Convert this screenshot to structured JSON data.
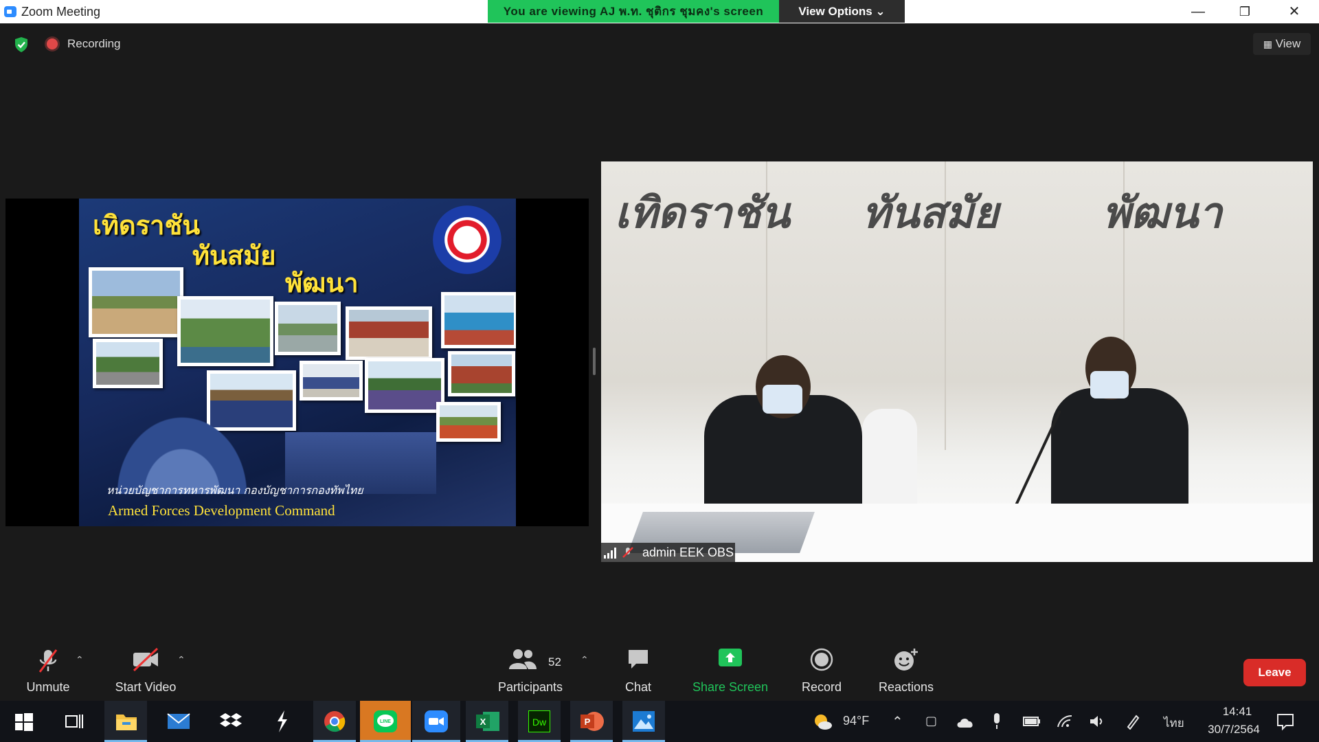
{
  "window": {
    "title": "Zoom Meeting",
    "viewing_banner": "You are viewing AJ พ.ท. ชุติกร ชุมคง's screen",
    "view_options": "View Options ⌄",
    "minimize": "—",
    "restore": "❐",
    "close": "✕"
  },
  "overlay": {
    "recording_label": "Recording",
    "view_label": "View"
  },
  "shared_slide": {
    "title_line1": "เทิดราชัน",
    "title_line2": "ทันสมัย",
    "title_line3": "พัฒนา",
    "caption_th": "หน่วยบัญชาการทหารพัฒนา  กองบัญชาการกองทัพไทย",
    "caption_en": "Armed Forces Development Command",
    "logo_text": "หน่วยบัญชาการทหารพัฒนา"
  },
  "camera": {
    "banner_words": [
      "เทิดราชัน",
      "ทันสมัย",
      "พัฒนา"
    ],
    "participant_name": "admin EEK OBS"
  },
  "toolbar": {
    "unmute": "Unmute",
    "start_video": "Start Video",
    "participants": "Participants",
    "participants_count": "52",
    "chat": "Chat",
    "share_screen": "Share Screen",
    "record": "Record",
    "reactions": "Reactions",
    "leave": "Leave",
    "share_color": "#20c45a"
  },
  "taskbar": {
    "weather": "94°F",
    "language": "ไทย",
    "time": "14:41",
    "date": "30/7/2564",
    "apps": [
      "start",
      "task-view",
      "file-explorer",
      "mail",
      "dropbox",
      "app-s",
      "chrome",
      "line",
      "zoom",
      "excel",
      "dreamweaver",
      "powerpoint",
      "photos"
    ]
  }
}
